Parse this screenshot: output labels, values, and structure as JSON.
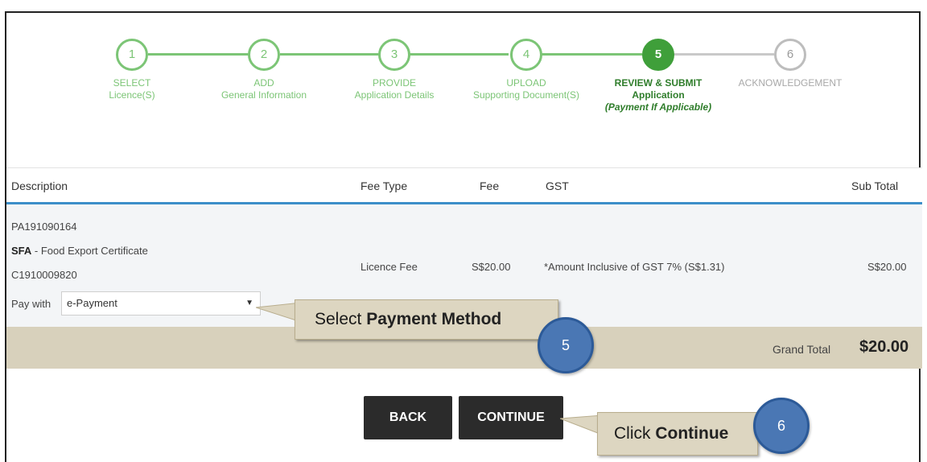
{
  "steps": [
    {
      "number": "1",
      "title": "SELECT",
      "subtitle": "Licence(S)"
    },
    {
      "number": "2",
      "title": "ADD",
      "subtitle": "General Information"
    },
    {
      "number": "3",
      "title": "PROVIDE",
      "subtitle": "Application Details"
    },
    {
      "number": "4",
      "title": "UPLOAD",
      "subtitle": "Supporting Document(S)"
    },
    {
      "number": "5",
      "title": "REVIEW & SUBMIT",
      "subtitle": "Application",
      "note": "(Payment If Applicable)"
    },
    {
      "number": "6",
      "title": "ACKNOWLEDGEMENT"
    }
  ],
  "table": {
    "headers": {
      "description": "Description",
      "fee_type": "Fee Type",
      "fee": "Fee",
      "gst": "GST",
      "sub_total": "Sub Total"
    },
    "row": {
      "ref_no": "PA191090164",
      "agency": "SFA",
      "licence_name": " - Food Export Certificate",
      "licence_no": "C1910009820",
      "pay_with_label": "Pay with",
      "payment_method": "e-Payment",
      "fee_type": "Licence Fee",
      "fee": "S$20.00",
      "gst": "*Amount Inclusive of GST 7% (S$1.31)",
      "sub_total": "S$20.00"
    },
    "grand_total_label": "Grand Total",
    "grand_total_value": "$20.00"
  },
  "buttons": {
    "back": "BACK",
    "continue": "CONTINUE"
  },
  "callouts": {
    "payment": {
      "prefix": "Select ",
      "bold": "Payment Method",
      "badge": "5"
    },
    "continue": {
      "prefix": "Click ",
      "bold": "Continue",
      "badge": "6"
    }
  },
  "colors": {
    "step_done": "#7cc576",
    "step_active": "#3f9f3a",
    "step_todo": "#bdbdbd",
    "header_underline": "#3c8fc9",
    "callout_bg": "#ddd6c1",
    "badge": "#4a77b4"
  }
}
